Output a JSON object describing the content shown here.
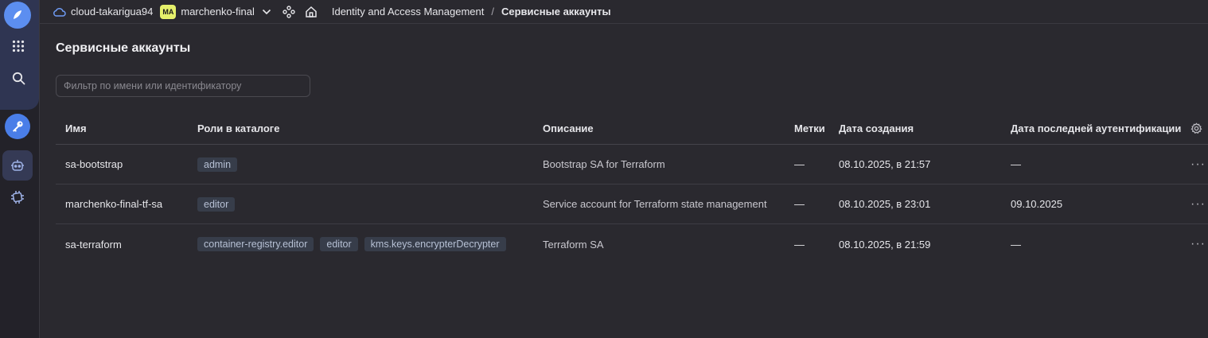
{
  "nav": {
    "logo_icon": "yandex-cloud-logo-icon",
    "services_icon": "grid-icon",
    "search_icon": "search-icon",
    "key_icon": "key-icon",
    "robot_icon": "robot-icon",
    "chip_icon": "chip-icon"
  },
  "topbar": {
    "cloud": "cloud-takarigua94",
    "folder_badge": "MA",
    "folder": "marchenko-final",
    "breadcrumb_service": "Identity and Access Management",
    "breadcrumb_separator": "/",
    "breadcrumb_current": "Сервисные аккаунты"
  },
  "page": {
    "title": "Сервисные аккаунты",
    "filter_placeholder": "Фильтр по имени или идентификатору"
  },
  "table": {
    "headers": {
      "name": "Имя",
      "roles": "Роли в каталоге",
      "description": "Описание",
      "labels": "Метки",
      "created": "Дата создания",
      "last_auth": "Дата последней аутентификации"
    },
    "rows": [
      {
        "name": "sa-bootstrap",
        "roles": [
          "admin"
        ],
        "description": "Bootstrap SA for Terraform",
        "labels": "—",
        "created": "08.10.2025, в 21:57",
        "last_auth": "—",
        "menu": "···"
      },
      {
        "name": "marchenko-final-tf-sa",
        "roles": [
          "editor"
        ],
        "description": "Service account for Terraform state management",
        "labels": "—",
        "created": "08.10.2025, в 23:01",
        "last_auth": "09.10.2025",
        "menu": "···"
      },
      {
        "name": "sa-terraform",
        "roles": [
          "container-registry.editor",
          "editor",
          "kms.keys.encrypterDecrypter"
        ],
        "description": "Terraform SA",
        "labels": "—",
        "created": "08.10.2025, в 21:59",
        "last_auth": "—",
        "menu": "···"
      }
    ]
  },
  "colors": {
    "background": "#2a292f",
    "rail": "#232229",
    "accent": "#4a7ee8",
    "role_chip": "#373d4a"
  }
}
